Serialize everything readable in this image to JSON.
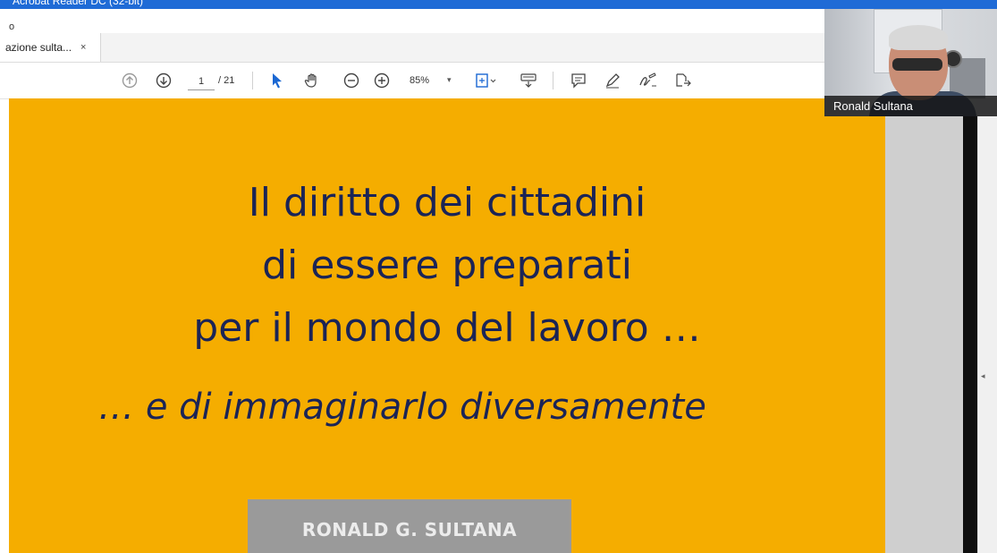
{
  "app": {
    "window_title": "Acrobat Reader DC (32-bit)",
    "menu_partial": "o"
  },
  "tab": {
    "label": "azione sulta...",
    "close": "×"
  },
  "toolbar": {
    "page_current": "1",
    "page_total": "/ 21",
    "zoom": "85%",
    "zoom_caret": "▾"
  },
  "slide": {
    "title_lines": [
      "Il diritto dei cittadini",
      "di essere preparati",
      "per il mondo del lavoro …"
    ],
    "subtitle": "… e di immaginarlo diversamente",
    "author": "RONALD G. SULTANA",
    "background_color": "#f5ad00",
    "text_color": "#1b2456"
  },
  "video": {
    "participant_name": "Ronald Sultana"
  },
  "scrollbar": {
    "arrow": "◂"
  }
}
